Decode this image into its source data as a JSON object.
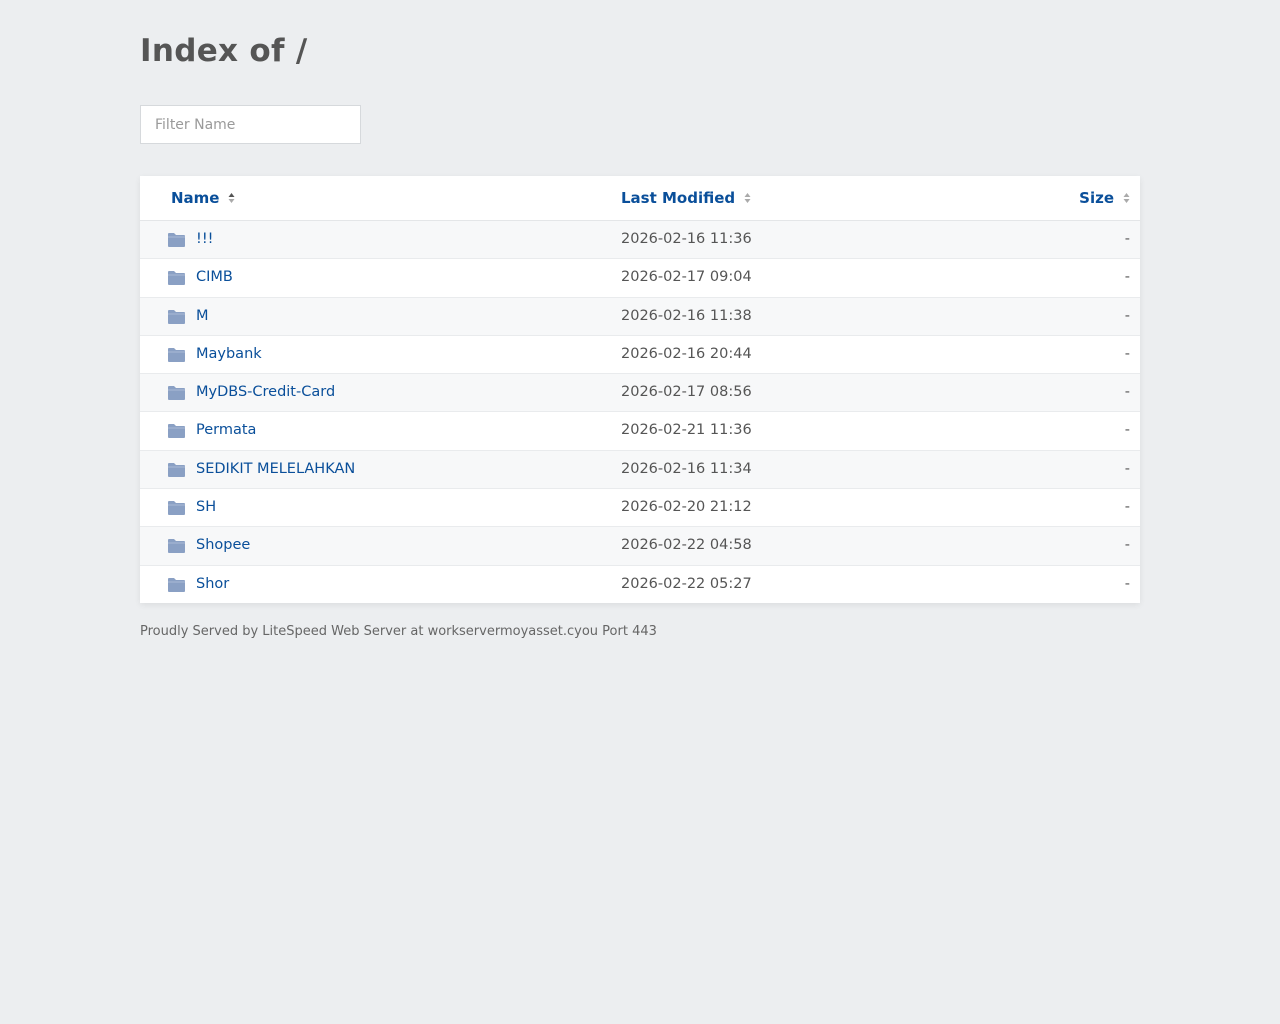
{
  "page": {
    "title": "Index of /"
  },
  "filter": {
    "placeholder": "Filter Name",
    "value": ""
  },
  "table": {
    "headers": {
      "name": "Name",
      "modified": "Last Modified",
      "size": "Size"
    },
    "rows": [
      {
        "name": "!!!",
        "modified": "2026-02-16 11:36",
        "size": "-"
      },
      {
        "name": "CIMB",
        "modified": "2026-02-17 09:04",
        "size": "-"
      },
      {
        "name": "M",
        "modified": "2026-02-16 11:38",
        "size": "-"
      },
      {
        "name": "Maybank",
        "modified": "2026-02-16 20:44",
        "size": "-"
      },
      {
        "name": "MyDBS-Credit-Card",
        "modified": "2026-02-17 08:56",
        "size": "-"
      },
      {
        "name": "Permata",
        "modified": "2026-02-21 11:36",
        "size": "-"
      },
      {
        "name": "SEDIKIT MELELAHKAN",
        "modified": "2026-02-16 11:34",
        "size": "-"
      },
      {
        "name": "SH",
        "modified": "2026-02-20 21:12",
        "size": "-"
      },
      {
        "name": "Shopee",
        "modified": "2026-02-22 04:58",
        "size": "-"
      },
      {
        "name": "Shor",
        "modified": "2026-02-22 05:27",
        "size": "-"
      }
    ]
  },
  "footer": {
    "text": "Proudly Served by LiteSpeed Web Server at workservermoyasset.cyou Port 443"
  },
  "colors": {
    "background": "#eceef0",
    "link": "#0a4f9a",
    "folder_icon": "#8aa0c4",
    "heading": "#555555"
  },
  "icons": {
    "row_icon": "folder-icon",
    "sort_icon": "sort-arrows-icon"
  }
}
